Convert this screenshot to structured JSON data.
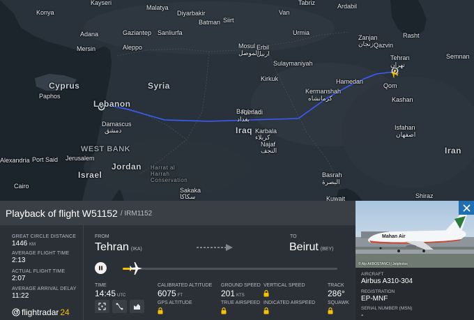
{
  "map": {
    "places": [
      {
        "id": "konya",
        "label": "Konya",
        "type": "city"
      },
      {
        "id": "kayseri",
        "label": "Kayseri",
        "type": "city"
      },
      {
        "id": "malatya",
        "label": "Malatya",
        "type": "city"
      },
      {
        "id": "diyarbakir",
        "label": "Diyarbakir",
        "type": "city"
      },
      {
        "id": "siirt",
        "label": "Siirt",
        "type": "city"
      },
      {
        "id": "batman",
        "label": "Batman",
        "type": "city"
      },
      {
        "id": "van",
        "label": "Van",
        "type": "city"
      },
      {
        "id": "tabriz",
        "label": "Tabriz",
        "type": "city"
      },
      {
        "id": "ardabil",
        "label": "Ardabil",
        "type": "city"
      },
      {
        "id": "urmia",
        "label": "Urmia",
        "type": "city"
      },
      {
        "id": "adana",
        "label": "Adana",
        "type": "city"
      },
      {
        "id": "gaziantep",
        "label": "Gaziantep",
        "type": "city"
      },
      {
        "id": "sanliurfa",
        "label": "Sanliurfa",
        "type": "city"
      },
      {
        "id": "mersin",
        "label": "Mersin",
        "type": "city"
      },
      {
        "id": "aleppo",
        "label": "Aleppo",
        "type": "city"
      },
      {
        "id": "mosul",
        "label": "Mosul",
        "type": "city"
      },
      {
        "id": "mosul_ar",
        "label": "الموصل",
        "type": "city"
      },
      {
        "id": "erbil",
        "label": "Erbil",
        "type": "city"
      },
      {
        "id": "erbil_ar",
        "label": "اربيل",
        "type": "city"
      },
      {
        "id": "zanjan",
        "label": "Zanjan",
        "type": "city"
      },
      {
        "id": "zanjan_fa",
        "label": "زنجان",
        "type": "city"
      },
      {
        "id": "rasht",
        "label": "Rasht",
        "type": "city"
      },
      {
        "id": "sulaymaniyah",
        "label": "Sulaymaniyah",
        "type": "city"
      },
      {
        "id": "kirkuk",
        "label": "Kirkuk",
        "type": "city"
      },
      {
        "id": "qazvin",
        "label": "Qazvin",
        "type": "city"
      },
      {
        "id": "tehran",
        "label": "Tehran",
        "type": "city"
      },
      {
        "id": "tehran_fa",
        "label": "تهران",
        "type": "city"
      },
      {
        "id": "semnan",
        "label": "Semnan",
        "type": "city"
      },
      {
        "id": "cyprus",
        "label": "Cyprus",
        "type": "country"
      },
      {
        "id": "syria",
        "label": "Syria",
        "type": "country"
      },
      {
        "id": "lebanon",
        "label": "Lebanon",
        "type": "country"
      },
      {
        "id": "hamedan",
        "label": "Hamedan",
        "type": "city"
      },
      {
        "id": "kermanshah",
        "label": "Kermanshah",
        "type": "city"
      },
      {
        "id": "kermanshah_fa",
        "label": "کرمانشاه",
        "type": "city"
      },
      {
        "id": "qom",
        "label": "Qom",
        "type": "city"
      },
      {
        "id": "kashan",
        "label": "Kashan",
        "type": "city"
      },
      {
        "id": "paphos",
        "label": "Paphos",
        "type": "city"
      },
      {
        "id": "damascus",
        "label": "Damascus",
        "type": "city"
      },
      {
        "id": "damascus_ar",
        "label": "دمشق",
        "type": "city"
      },
      {
        "id": "baghdad",
        "label": "Baghdad",
        "type": "city"
      },
      {
        "id": "baghdad_ar",
        "label": "بغداد",
        "type": "city"
      },
      {
        "id": "ramadi",
        "label": "Ramadi",
        "type": "city"
      },
      {
        "id": "iraq",
        "label": "Iraq",
        "type": "country"
      },
      {
        "id": "karbala",
        "label": "Karbala",
        "type": "city"
      },
      {
        "id": "karbala_ar",
        "label": "كربلاء",
        "type": "city"
      },
      {
        "id": "isfahan",
        "label": "Isfahan",
        "type": "city"
      },
      {
        "id": "isfahan_fa",
        "label": "اصفهان",
        "type": "city"
      },
      {
        "id": "westbank",
        "label": "WEST BANK",
        "type": "region"
      },
      {
        "id": "najaf",
        "label": "Najaf",
        "type": "city"
      },
      {
        "id": "najaf_ar",
        "label": "النجف",
        "type": "city"
      },
      {
        "id": "iran",
        "label": "Iran",
        "type": "country"
      },
      {
        "id": "port_said",
        "label": "Port Said",
        "type": "city"
      },
      {
        "id": "jerusalem",
        "label": "Jerusalem",
        "type": "city"
      },
      {
        "id": "jordan",
        "label": "Jordan",
        "type": "country"
      },
      {
        "id": "alexandria",
        "label": "Alexandria",
        "type": "city"
      },
      {
        "id": "harrat",
        "label": "Harrat al Harrah Conservation",
        "type": "region"
      },
      {
        "id": "israel",
        "label": "Israel",
        "type": "country"
      },
      {
        "id": "basrah",
        "label": "Basrah",
        "type": "city"
      },
      {
        "id": "basrah_ar",
        "label": "البصرة",
        "type": "city"
      },
      {
        "id": "cairo",
        "label": "Cairo",
        "type": "city"
      },
      {
        "id": "sakaka",
        "label": "Sakaka",
        "type": "city"
      },
      {
        "id": "sakaka_ar",
        "label": "سكاكا",
        "type": "city"
      },
      {
        "id": "shiraz",
        "label": "Shiraz",
        "type": "city"
      },
      {
        "id": "kuwait",
        "label": "Kuwait",
        "type": "city"
      }
    ]
  },
  "flight": {
    "title": "Playback of flight W51152",
    "callsign": "/ IRM1152",
    "stats": [
      {
        "label": "GREAT CIRCLE DISTANCE",
        "value": "1446",
        "unit": "KM"
      },
      {
        "label": "AVERAGE FLIGHT TIME",
        "value": "2:13",
        "unit": ""
      },
      {
        "label": "ACTUAL FLIGHT TIME",
        "value": "2:07",
        "unit": ""
      },
      {
        "label": "AVERAGE ARRIVAL DELAY",
        "value": "11:22",
        "unit": ""
      }
    ],
    "from_label": "FROM",
    "from_city": "Tehran",
    "from_code": "(IKA)",
    "to_label": "TO",
    "to_city": "Beirut",
    "to_code": "(BEY)",
    "progress": 0.07,
    "time_label": "TIME",
    "time_value": "14:45",
    "time_unit": "UTC",
    "cal_alt_label": "CALIBRATED ALTITUDE",
    "cal_alt_value": "6075",
    "cal_alt_unit": "FT",
    "gs_label": "GROUND SPEED",
    "gs_value": "201",
    "gs_unit": "KTS",
    "vs_label": "VERTICAL SPEED",
    "track_label": "TRACK",
    "track_value": "286°",
    "gps_alt_label": "GPS ALTITUDE",
    "tas_label": "TRUE AIRSPEED",
    "ias_label": "INDICATED AIRSPEED",
    "squawk_label": "SQUAWK"
  },
  "logo": {
    "main": "flightradar",
    "suffix": "24"
  },
  "aircraft": {
    "photo_credit": "© Alp AKBOSTANCI | Jetphotos",
    "livery_text": "Mahan Air",
    "aircraft_label": "AIRCRAFT",
    "aircraft_value": "Airbus A310-304",
    "registration_label": "REGISTRATION",
    "registration_value": "EP-MNF",
    "serial_label": "SERIAL NUMBER (MSN)",
    "serial_value": "-"
  },
  "colors": {
    "accent": "#f7c100",
    "route": "#3b5cff",
    "close": "#1f6fb2"
  }
}
